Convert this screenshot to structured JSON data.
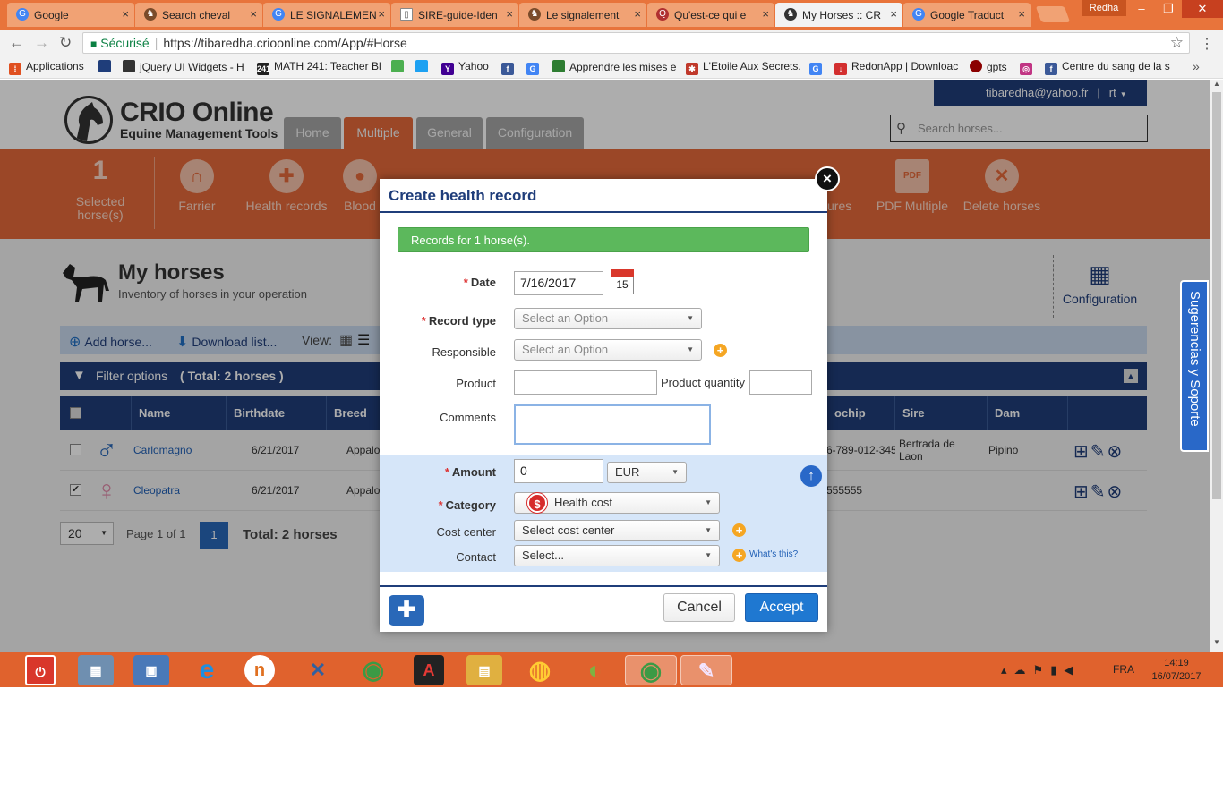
{
  "browser": {
    "tabs": [
      {
        "title": "Google",
        "favicon_color": "#4285f4",
        "favicon": "G"
      },
      {
        "title": "Search cheval",
        "favicon_color": "#7a4b2a",
        "favicon": "♞"
      },
      {
        "title": "LE SIGNALEMEN",
        "favicon_color": "#4285f4",
        "favicon": "G"
      },
      {
        "title": "SIRE-guide-Iden",
        "favicon_color": "#ffffff",
        "favicon": "▯"
      },
      {
        "title": "Le signalement",
        "favicon_color": "#7a4b2a",
        "favicon": "♞"
      },
      {
        "title": "Qu'est-ce qui e",
        "favicon_color": "#b03030",
        "favicon": "Q"
      },
      {
        "title": "My Horses :: CR",
        "favicon_color": "#333333",
        "favicon": "♞"
      },
      {
        "title": "Google Traduct",
        "favicon_color": "#4285f4",
        "favicon": "G"
      }
    ],
    "profile": "Redha",
    "secure_label": "Sécurisé",
    "url": "https://tibaredha.crioonline.com/App/#Horse",
    "bookmarks": [
      {
        "label": "Applications",
        "color": "#e05020"
      },
      {
        "label": "",
        "color": "#1f3d7a"
      },
      {
        "label": "jQuery UI Widgets - H",
        "color": "#333333"
      },
      {
        "label": "MATH 241: Teacher Bl",
        "color": "#222222"
      },
      {
        "label": "",
        "color": "#4caf50"
      },
      {
        "label": "",
        "color": "#1da1f2"
      },
      {
        "label": "Yahoo",
        "color": "#410093"
      },
      {
        "label": "",
        "color": "#3b5998"
      },
      {
        "label": "",
        "color": "#4285f4"
      },
      {
        "label": "Apprendre les mises e",
        "color": "#2e7d32"
      },
      {
        "label": "L'Etoile Aux Secrets.",
        "color": "#c0392b"
      },
      {
        "label": "",
        "color": "#4285f4"
      },
      {
        "label": "RedonApp | Downloac",
        "color": "#d32f2f"
      },
      {
        "label": "gpts",
        "color": "#8b0000"
      },
      {
        "label": "",
        "color": "#c13584"
      },
      {
        "label": "Centre du sang de la s",
        "color": "#3b5998"
      }
    ]
  },
  "app": {
    "logo_title": "CRIO Online",
    "logo_subtitle": "Equine Management Tools",
    "nav": [
      "Home",
      "Multiple",
      "General",
      "Configuration"
    ],
    "user": "tibaredha@yahoo.fr",
    "user_menu": "rt",
    "search_placeholder": "Search horses...",
    "selected_count": "1",
    "selected_label": "Selected horse(s)",
    "toolbar": [
      "Farrier",
      "Health records",
      "Blood",
      "ures",
      "PDF Multiple",
      "Delete horses"
    ],
    "page_title": "My horses",
    "page_subtitle": "Inventory of horses in your operation",
    "config_label": "Configuration",
    "actions": {
      "add": "Add horse...",
      "download": "Download list...",
      "view": "View:"
    },
    "filter_label": "Filter options",
    "filter_total": "( Total: 2 horses )",
    "columns": [
      "Name",
      "Birthdate",
      "Breed",
      "ochip",
      "Sire",
      "Dam"
    ],
    "rows": [
      {
        "sex": "♂",
        "sex_color": "#2968b8",
        "name": "Carlomagno",
        "birthdate": "6/21/2017",
        "breed": "Appalo",
        "chip": "6-789-012-345",
        "sire": "Bertrada de Laon",
        "dam": "Pipino",
        "checked": ""
      },
      {
        "sex": "♀",
        "sex_color": "#e08aa8",
        "name": "Cleopatra",
        "birthdate": "6/21/2017",
        "breed": "Appalo",
        "chip": "555555",
        "sire": "",
        "dam": "",
        "checked": "✔"
      }
    ],
    "page_size": "20",
    "page_of": "Page 1 of 1",
    "page_num": "1",
    "page_total": "Total: 2 horses",
    "support": "Sugerencias y Soporte"
  },
  "dialog": {
    "title": "Create health record",
    "alert": "Records for 1 horse(s).",
    "date_label": "Date",
    "date_value": "7/16/2017",
    "calendar_day": "15",
    "record_type_label": "Record type",
    "record_type_placeholder": "Select an Option",
    "responsible_label": "Responsible",
    "responsible_placeholder": "Select an Option",
    "product_label": "Product",
    "product_qty_label": "Product quantity",
    "comments_label": "Comments",
    "amount_label": "Amount",
    "amount_value": "0",
    "currency": "EUR",
    "category_label": "Category",
    "category_value": "Health cost",
    "cost_center_label": "Cost center",
    "cost_center_placeholder": "Select cost center",
    "contact_label": "Contact",
    "contact_placeholder": "Select...",
    "whats_this": "What's this?",
    "cancel": "Cancel",
    "accept": "Accept"
  },
  "taskbar": {
    "apps": [
      {
        "name": "power",
        "color": "#d9372b",
        "glyph": "⏻"
      },
      {
        "name": "calculator",
        "color": "#6f8fb0",
        "glyph": "▦"
      },
      {
        "name": "control-panel",
        "color": "#4a79b8",
        "glyph": "▣"
      },
      {
        "name": "ie",
        "color": "#1e8fe0",
        "glyph": "e"
      },
      {
        "name": "app-n",
        "color": "#e07020",
        "glyph": "n"
      },
      {
        "name": "tools",
        "color": "#3060a0",
        "glyph": "✕"
      },
      {
        "name": "chrome",
        "color": "#3c9a45",
        "glyph": "◉"
      },
      {
        "name": "pdf",
        "color": "#b71c1c",
        "glyph": "A"
      },
      {
        "name": "explorer",
        "color": "#e0b040",
        "glyph": "▤"
      },
      {
        "name": "firefox",
        "color": "#e66000",
        "glyph": "◍"
      },
      {
        "name": "app-green",
        "color": "#7cb342",
        "glyph": "◐"
      },
      {
        "name": "chrome-active",
        "color": "#3c9a45",
        "glyph": "◉"
      },
      {
        "name": "paint",
        "color": "#9c7cc0",
        "glyph": "✎"
      }
    ],
    "lang": "FRA",
    "time": "14:19",
    "date": "16/07/2017"
  }
}
